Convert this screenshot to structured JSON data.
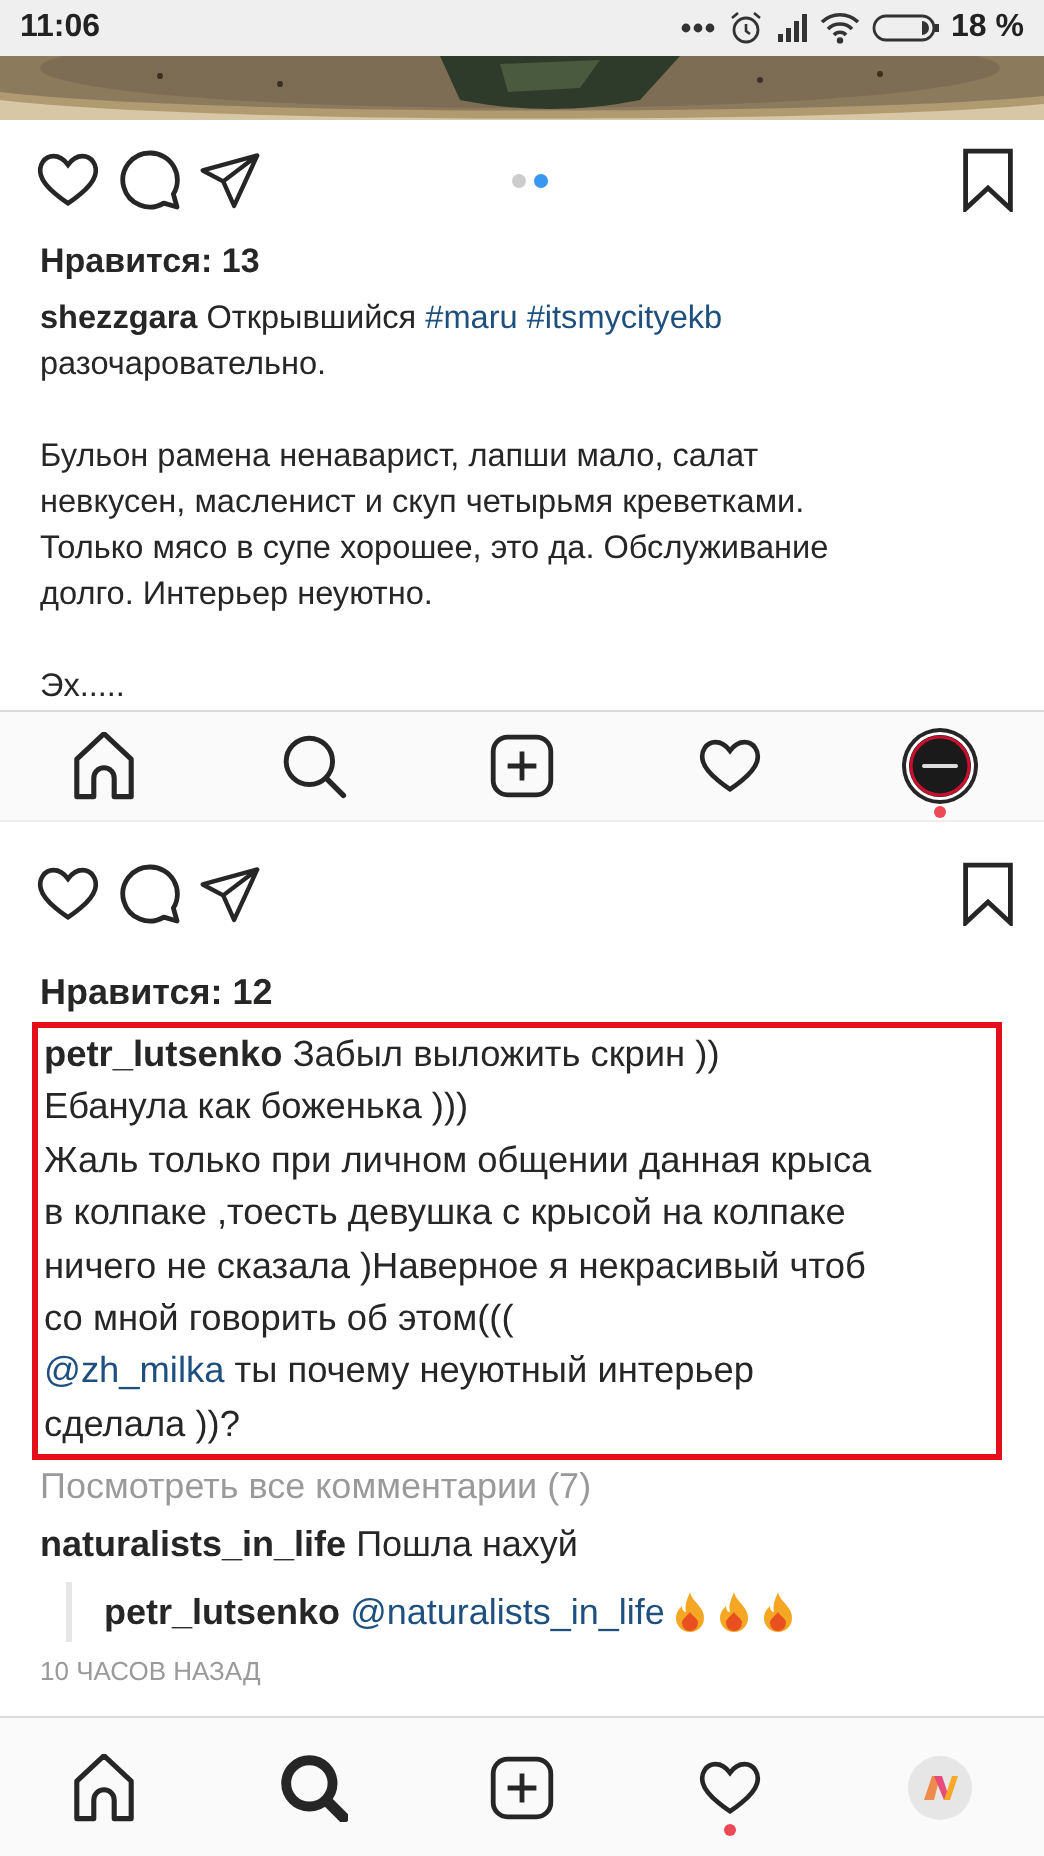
{
  "status_bar": {
    "time": "11:06",
    "battery_text": "18 %"
  },
  "post_top": {
    "carousel_dots": [
      {
        "selected": false
      },
      {
        "selected": true
      }
    ],
    "liked": false,
    "saved": false,
    "likes": "Нравится: 13",
    "caption": [
      {
        "segments": [
          {
            "kind": "user",
            "text": "shezzgara"
          },
          {
            "kind": "text",
            "text": " Открывшийся "
          },
          {
            "kind": "tag",
            "text": "#maru"
          },
          {
            "kind": "tag",
            "text": "#itsmycityekb"
          },
          {
            "kind": "text",
            "text": "\nразочаровательно."
          }
        ]
      },
      {
        "segments": [
          {
            "kind": "text",
            "text": "Бульон рамена ненаварист, лапши мало, салат\nневкусен, масленист и скуп четырьмя креветками.\nТолько мясо в супе хорошее, это да. Обслуживание\nдолго. Интерьер неуютно."
          }
        ]
      },
      {
        "segments": [
          {
            "kind": "text",
            "text": "Эх....."
          }
        ]
      }
    ]
  },
  "nav_bar_top": {
    "items": [
      {
        "kind": "home",
        "selected": false,
        "notification": false
      },
      {
        "kind": "search",
        "selected": false,
        "notification": false
      },
      {
        "kind": "create",
        "selected": false,
        "notification": false
      },
      {
        "kind": "activity",
        "selected": false,
        "notification": false
      },
      {
        "kind": "profile",
        "selected": true,
        "notification": true
      }
    ]
  },
  "post_bottom": {
    "liked": false,
    "saved": false,
    "likes": "Нравится: 12",
    "comments": [
      {
        "highlighted": true,
        "segments": [
          {
            "kind": "user",
            "text": "petr_lutsenko"
          },
          {
            "kind": "text",
            "text": " Забыл выложить скрин ))\nЕбанула как боженька )))\nЖаль только при личном общении данная крыса\nв колпаке ,тоесть девушка с крысой на колпаке\nничего не сказала )Наверное я некрасивый чтоб\nсо мной говорить об этом(((\n"
          },
          {
            "kind": "tag",
            "text": "@zh_milka"
          },
          {
            "kind": "text",
            "text": " ты почему неуютный интерьер\nсделала ))?"
          }
        ]
      }
    ],
    "view_all": "Посмотреть все комментарии (7)",
    "more_comments": [
      {
        "reply": false,
        "segments": [
          {
            "kind": "user",
            "text": "naturalists_in_life"
          },
          {
            "kind": "text",
            "text": " Пошла нахуй"
          }
        ]
      },
      {
        "reply": true,
        "segments": [
          {
            "kind": "user",
            "text": "petr_lutsenko"
          },
          {
            "kind": "tag",
            "text": "@naturalists_in_life"
          }
        ],
        "reactions": [
          {
            "kind": "fire"
          },
          {
            "kind": "fire"
          },
          {
            "kind": "fire"
          }
        ]
      }
    ],
    "time": "10 ЧАСОВ НАЗАД"
  },
  "nav_bar_bottom": {
    "items": [
      {
        "kind": "home",
        "selected": false,
        "notification": false
      },
      {
        "kind": "search",
        "selected": true,
        "notification": false
      },
      {
        "kind": "create",
        "selected": false,
        "notification": false
      },
      {
        "kind": "activity",
        "selected": false,
        "notification": true
      },
      {
        "kind": "profile",
        "selected": false,
        "notification": false
      }
    ]
  }
}
